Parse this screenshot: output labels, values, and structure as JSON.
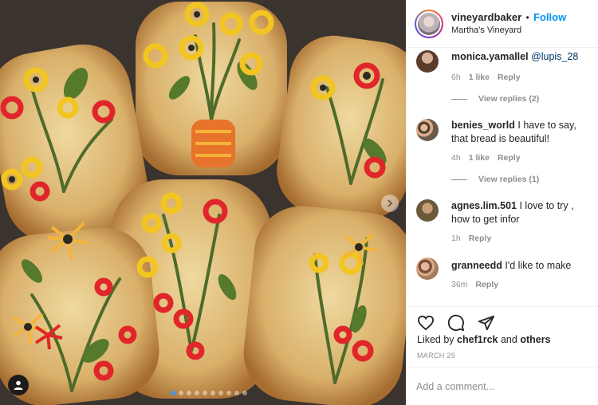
{
  "post": {
    "username": "vineyardbaker",
    "separator": "•",
    "follow_label": "Follow",
    "location": "Martha's Vineyard",
    "likes_prefix": "Liked by",
    "liked_by_user": "chef1rck",
    "likes_and": "and",
    "likes_others": "others",
    "date": "MARCH 29",
    "add_comment_placeholder": "Add a comment...",
    "carousel_total": 10,
    "carousel_active": 1
  },
  "comments": [
    {
      "username": "monica.yamallel",
      "text": "",
      "mention": "@lupis_28",
      "time": "6h",
      "likes": "1 like",
      "reply": "Reply",
      "view_replies": "View replies (2)"
    },
    {
      "username": "benies_world",
      "text": "I have to say, that bread is beautiful!",
      "mention": "",
      "time": "4h",
      "likes": "1 like",
      "reply": "Reply",
      "view_replies": "View replies (1)"
    },
    {
      "username": "agnes.lim.501",
      "text": "I love to try , how to get infor",
      "mention": "",
      "time": "1h",
      "likes": "",
      "reply": "Reply",
      "view_replies": ""
    },
    {
      "username": "granneedd",
      "text": "I'd like to make",
      "mention": "",
      "time": "36m",
      "likes": "",
      "reply": "Reply",
      "view_replies": ""
    }
  ],
  "icons": [
    "heart-icon",
    "comment-icon",
    "share-icon",
    "user-tag-icon",
    "chevron-right-icon"
  ],
  "colors": {
    "follow": "#0095f6",
    "mention": "#00376b",
    "muted": "#8e8e8e",
    "carousel_active": "#3897f0"
  }
}
